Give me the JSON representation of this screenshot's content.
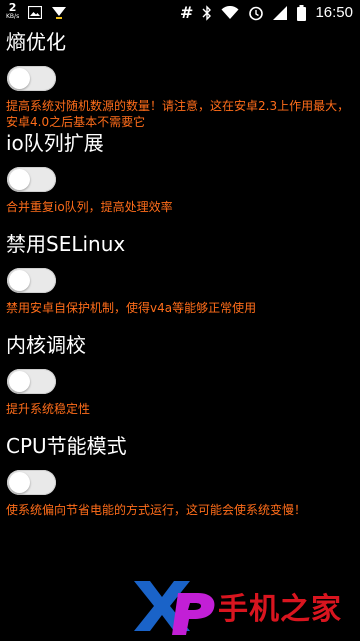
{
  "status_bar": {
    "net_speed": "2",
    "net_unit": "KB/s",
    "hash_symbol": "#",
    "time": "16:50",
    "icons": [
      "image-icon",
      "download-icon",
      "bluetooth-icon",
      "wifi-icon",
      "alarm-icon",
      "signal-icon",
      "battery-icon"
    ]
  },
  "settings": [
    {
      "title": "熵优化",
      "enabled": false,
      "description": "提高系统对随机数源的数量！请注意，这在安卓2.3上作用最大，安卓4.0之后基本不需要它"
    },
    {
      "title": "io队列扩展",
      "enabled": false,
      "description": "合并重复io队列，提高处理效率"
    },
    {
      "title": "禁用SELinux",
      "enabled": false,
      "description": "禁用安卓自保护机制，使得v4a等能够正常使用"
    },
    {
      "title": "内核调校",
      "enabled": false,
      "description": "提升系统稳定性"
    },
    {
      "title": "CPU节能模式",
      "enabled": false,
      "description": "使系统偏向节省电能的方式运行，这可能会使系统变慢！"
    }
  ],
  "watermark": {
    "logo_text": "Xp",
    "site_text": "手机之家"
  },
  "colors": {
    "background": "#000000",
    "title": "#ffffff",
    "description": "#ff6d1a",
    "toggle_track": "#e9e9e9",
    "watermark_red": "#d9151f",
    "watermark_blue": "#1a63c8",
    "watermark_purple": "#c21fd6"
  }
}
